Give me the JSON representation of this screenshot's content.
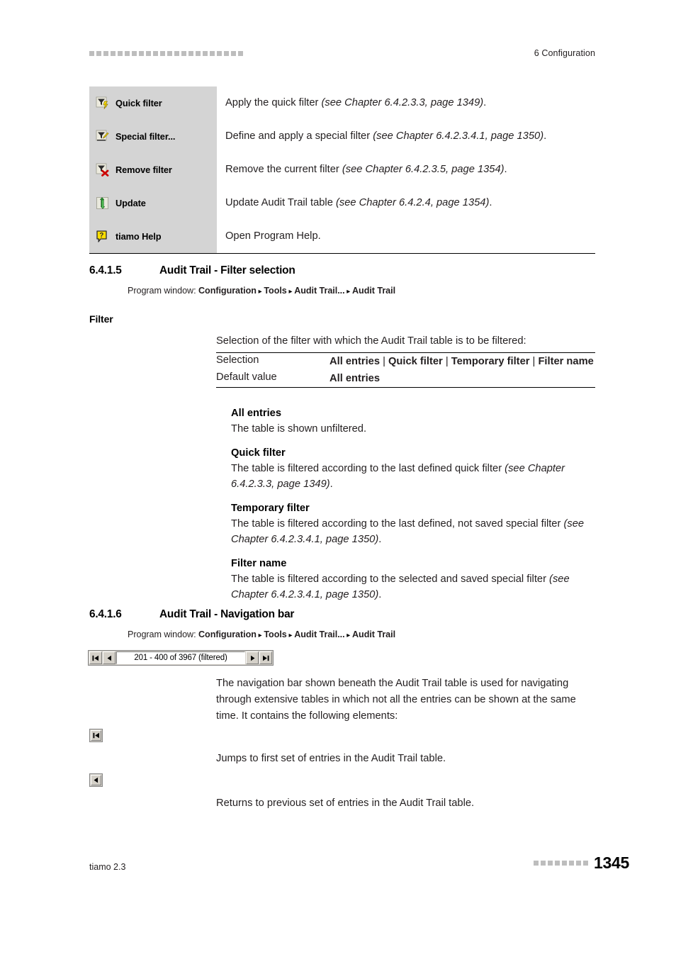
{
  "header": {
    "squares_count": 22,
    "running_title": "6 Configuration"
  },
  "icon_table": {
    "rows": [
      {
        "icon": "funnel-lightning-icon",
        "label": "Quick filter",
        "desc_plain": "Apply the quick filter ",
        "desc_italic": "(see Chapter 6.4.2.3.3, page 1349)",
        "desc_tail": "."
      },
      {
        "icon": "funnel-pencil-icon",
        "label": "Special filter...",
        "desc_plain": "Define and apply a special filter ",
        "desc_italic": "(see Chapter 6.4.2.3.4.1, page 1350)",
        "desc_tail": "."
      },
      {
        "icon": "funnel-delete-icon",
        "label": "Remove filter",
        "desc_plain": "Remove the current filter ",
        "desc_italic": "(see Chapter 6.4.2.3.5, page 1354)",
        "desc_tail": "."
      },
      {
        "icon": "refresh-arrows-icon",
        "label": "Update",
        "desc_plain": "Update Audit Trail table ",
        "desc_italic": "(see Chapter 6.4.2.4, page 1354)",
        "desc_tail": "."
      },
      {
        "icon": "help-question-icon",
        "label": "tiamo Help",
        "desc_plain": "Open Program Help.",
        "desc_italic": "",
        "desc_tail": ""
      }
    ]
  },
  "section_filter": {
    "number": "6.4.1.5",
    "title": "Audit Trail - Filter selection",
    "program_window_label": "Program window: ",
    "breadcrumb": [
      "Configuration",
      "Tools",
      "Audit Trail...",
      "Audit Trail"
    ],
    "marginal": "Filter",
    "intro": "Selection of the filter with which the Audit Trail table is to be filtered:",
    "table": {
      "selection_key": "Selection",
      "selection_values": [
        "All entries",
        "Quick filter",
        "Temporary filter",
        "Filter name"
      ],
      "default_key": "Default value",
      "default_value": "All entries"
    },
    "definitions": [
      {
        "term": "All entries",
        "desc_plain": "The table is shown unfiltered.",
        "desc_italic": "",
        "desc_tail": ""
      },
      {
        "term": "Quick filter",
        "desc_plain": "The table is filtered according to the last defined quick filter ",
        "desc_italic": "(see Chapter 6.4.2.3.3, page 1349)",
        "desc_tail": "."
      },
      {
        "term": "Temporary filter",
        "desc_plain": "The table is filtered according to the last defined, not saved special filter ",
        "desc_italic": "(see Chapter 6.4.2.3.4.1, page 1350)",
        "desc_tail": "."
      },
      {
        "term": "Filter name",
        "desc_plain": "The table is filtered according to the selected and saved special filter ",
        "desc_italic": "(see Chapter 6.4.2.3.4.1, page 1350)",
        "desc_tail": "."
      }
    ]
  },
  "section_navbar": {
    "number": "6.4.1.6",
    "title": "Audit Trail - Navigation bar",
    "program_window_label": "Program window: ",
    "breadcrumb": [
      "Configuration",
      "Tools",
      "Audit Trail...",
      "Audit Trail"
    ],
    "widget": {
      "first_button_icon": "jump-to-first-icon",
      "prev_button_icon": "previous-icon",
      "range_text": "201 - 400 of 3967  (filtered)",
      "next_button_icon": "next-icon",
      "last_button_icon": "jump-to-last-icon"
    },
    "intro": "The navigation bar shown beneath the Audit Trail table is used for navigating through extensive tables in which not all the entries can be shown at the same time. It contains the following elements:",
    "items": [
      {
        "icon": "jump-to-first-icon",
        "desc": "Jumps to first set of entries in the Audit Trail table."
      },
      {
        "icon": "previous-icon",
        "desc": "Returns to previous set of entries in the Audit Trail table."
      }
    ]
  },
  "footer": {
    "product": "tiamo 2.3",
    "squares_count": 8,
    "page_number": "1345"
  },
  "colors": {
    "icon_cell_bg": "#d4d4d4",
    "marker_gray": "#bdbdbd",
    "text": "#231f20",
    "widget_face": "#d4d0c8"
  }
}
